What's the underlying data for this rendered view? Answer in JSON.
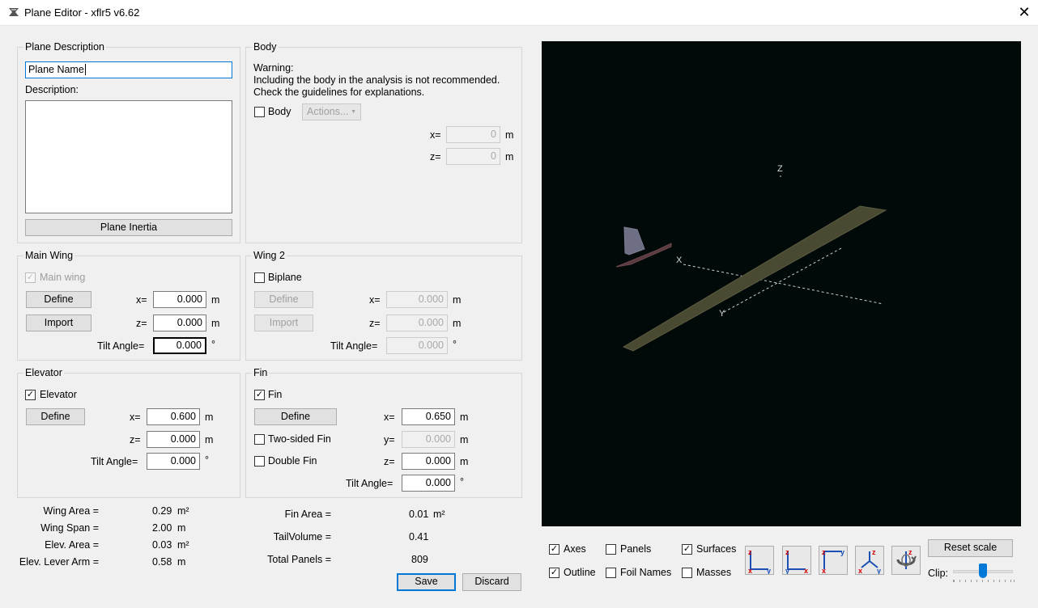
{
  "window": {
    "title": "Plane Editor - xflr5 v6.62",
    "close_glyph": "✕"
  },
  "plane_description": {
    "group_title": "Plane Description",
    "name_value": "Plane Name",
    "description_label": "Description:",
    "description_value": "",
    "inertia_button": "Plane Inertia"
  },
  "body": {
    "group_title": "Body",
    "warning_line1": "Warning:",
    "warning_line2": "Including the body in the analysis is not recommended.",
    "warning_line3": "Check the guidelines for explanations.",
    "checkbox_label": "Body",
    "checked": false,
    "actions_button": "Actions...",
    "x_label": "x=",
    "x_value": "0",
    "x_unit": "m",
    "z_label": "z=",
    "z_value": "0",
    "z_unit": "m"
  },
  "main_wing": {
    "group_title": "Main Wing",
    "checkbox_label": "Main wing",
    "checked": true,
    "define_button": "Define",
    "import_button": "Import",
    "x_label": "x=",
    "x_value": "0.000",
    "x_unit": "m",
    "z_label": "z=",
    "z_value": "0.000",
    "z_unit": "m",
    "tilt_label": "Tilt Angle=",
    "tilt_value": "0.000",
    "tilt_unit": "°"
  },
  "wing2": {
    "group_title": "Wing 2",
    "checkbox_label": "Biplane",
    "checked": false,
    "define_button": "Define",
    "import_button": "Import",
    "x_label": "x=",
    "x_value": "0.000",
    "x_unit": "m",
    "z_label": "z=",
    "z_value": "0.000",
    "z_unit": "m",
    "tilt_label": "Tilt Angle=",
    "tilt_value": "0.000",
    "tilt_unit": "°"
  },
  "elevator": {
    "group_title": "Elevator",
    "checkbox_label": "Elevator",
    "checked": true,
    "define_button": "Define",
    "x_label": "x=",
    "x_value": "0.600",
    "x_unit": "m",
    "z_label": "z=",
    "z_value": "0.000",
    "z_unit": "m",
    "tilt_label": "Tilt Angle=",
    "tilt_value": "0.000",
    "tilt_unit": "°"
  },
  "fin": {
    "group_title": "Fin",
    "checkbox_label": "Fin",
    "checked": true,
    "define_button": "Define",
    "two_sided_label": "Two-sided Fin",
    "two_sided_checked": false,
    "double_fin_label": "Double Fin",
    "double_fin_checked": false,
    "x_label": "x=",
    "x_value": "0.650",
    "x_unit": "m",
    "y_label": "y=",
    "y_value": "0.000",
    "y_unit": "m",
    "z_label": "z=",
    "z_value": "0.000",
    "z_unit": "m",
    "tilt_label": "Tilt Angle=",
    "tilt_value": "0.000",
    "tilt_unit": "°"
  },
  "stats": {
    "wing_area_label": "Wing Area =",
    "wing_area_value": "0.29",
    "wing_area_unit": "m²",
    "wing_span_label": "Wing Span =",
    "wing_span_value": "2.00",
    "wing_span_unit": "m",
    "elev_area_label": "Elev. Area =",
    "elev_area_value": "0.03",
    "elev_area_unit": "m²",
    "elev_lever_label": "Elev. Lever Arm =",
    "elev_lever_value": "0.58",
    "elev_lever_unit": "m",
    "fin_area_label": "Fin Area =",
    "fin_area_value": "0.01",
    "fin_area_unit": "m²",
    "tail_volume_label": "TailVolume =",
    "tail_volume_value": "0.41",
    "total_panels_label": "Total Panels =",
    "total_panels_value": "809"
  },
  "actions": {
    "save_button": "Save",
    "discard_button": "Discard"
  },
  "view3d": {
    "background": "#020a09",
    "axis_x_label": "X",
    "axis_y_label": "Y",
    "axis_z_label": "Z",
    "wing_color": "#4a4a33",
    "elevator_color": "#5a3a3f",
    "fin_color": "#6e6e84"
  },
  "view_options": {
    "axes_label": "Axes",
    "axes_checked": true,
    "panels_label": "Panels",
    "panels_checked": false,
    "surfaces_label": "Surfaces",
    "surfaces_checked": true,
    "outline_label": "Outline",
    "outline_checked": true,
    "foil_names_label": "Foil Names",
    "foil_names_checked": false,
    "masses_label": "Masses",
    "masses_checked": false,
    "reset_scale_button": "Reset scale",
    "clip_label": "Clip:",
    "clip_level": 0.5,
    "view_buttons": [
      "front-view-icon",
      "side-view-icon",
      "top-view-icon",
      "iso-view-icon",
      "rotate-view-icon"
    ]
  }
}
